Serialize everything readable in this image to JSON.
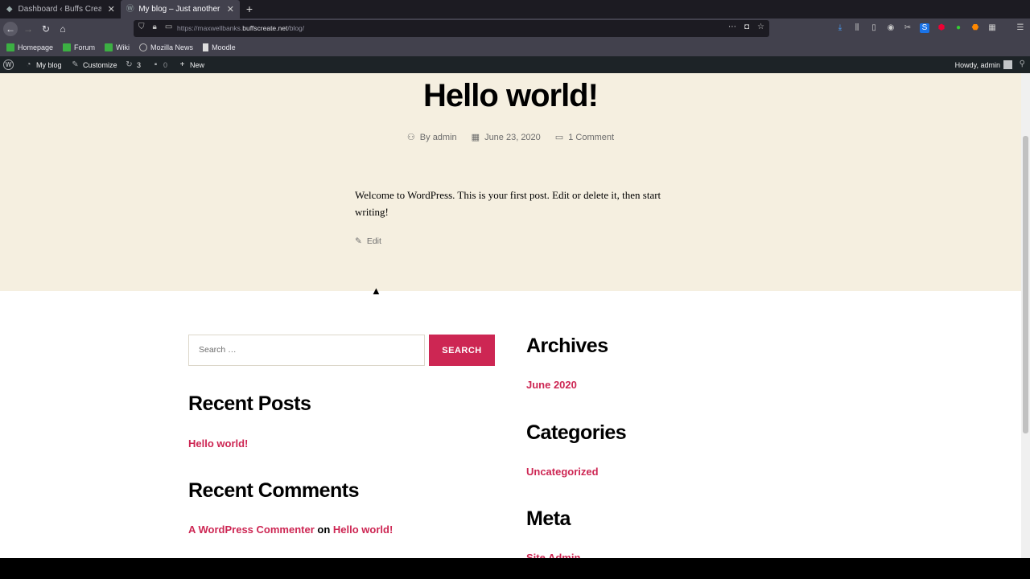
{
  "browser": {
    "tabs": [
      {
        "title": "Dashboard ‹ Buffs Create",
        "icon": "shield-icon"
      },
      {
        "title": "My blog – Just another Wo",
        "icon": "wordpress-icon"
      }
    ],
    "url_prefix": "https://maxwellbanks.",
    "url_domain": "buffscreate.net",
    "url_path": "/blog/",
    "bookmarks": [
      "Homepage",
      "Forum",
      "Wiki",
      "Mozilla News",
      "Moodle"
    ]
  },
  "adminbar": {
    "site": "My blog",
    "customize": "Customize",
    "updates": "3",
    "comments": "0",
    "new": "New",
    "howdy": "Howdy, admin"
  },
  "post": {
    "title": "Hello world!",
    "author": "By admin",
    "date": "June 23, 2020",
    "comments": "1 Comment",
    "body": "Welcome to WordPress. This is your first post. Edit or delete it, then start writing!",
    "edit": "Edit"
  },
  "widgets": {
    "search_placeholder": "Search …",
    "search_button": "SEARCH",
    "recent_posts_title": "Recent Posts",
    "recent_post_1": "Hello world!",
    "recent_comments_title": "Recent Comments",
    "commenter": "A WordPress Commenter",
    "comment_on": "on",
    "comment_post": "Hello world!",
    "archives_title": "Archives",
    "archive_1": "June 2020",
    "categories_title": "Categories",
    "category_1": "Uncategorized",
    "meta_title": "Meta",
    "meta_1": "Site Admin"
  },
  "colors": {
    "accent": "#cd2653",
    "post_bg": "#f5efe0",
    "adminbar_bg": "#1d2327"
  }
}
